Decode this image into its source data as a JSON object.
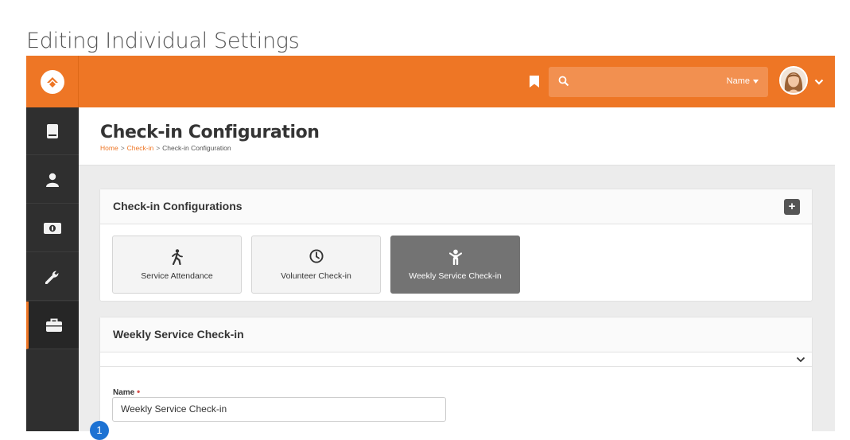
{
  "doc": {
    "heading": "Editing Individual Settings",
    "step_number": "1"
  },
  "topbar": {
    "search_filter_label": "Name",
    "colors": {
      "brand": "#ee7625",
      "sidebar": "#2f2f2f"
    }
  },
  "sidebar": {
    "items": [
      {
        "icon": "book-icon"
      },
      {
        "icon": "person-icon"
      },
      {
        "icon": "money-icon"
      },
      {
        "icon": "wrench-icon"
      },
      {
        "icon": "briefcase-icon",
        "active": true
      }
    ]
  },
  "page": {
    "title": "Check-in Configuration",
    "breadcrumb": [
      "Home",
      "Check-in",
      "Check-in Configuration"
    ],
    "breadcrumb_separator": ">"
  },
  "configs_panel": {
    "title": "Check-in Configurations",
    "add_label": "+",
    "cards": [
      {
        "label": "Service Attendance",
        "icon": "walking-person-icon"
      },
      {
        "label": "Volunteer Check-in",
        "icon": "clock-icon"
      },
      {
        "label": "Weekly Service Check-in",
        "icon": "child-icon",
        "selected": true
      }
    ]
  },
  "detail_panel": {
    "title": "Weekly Service Check-in",
    "name_label": "Name",
    "required_mark": "•",
    "name_value": "Weekly Service Check-in"
  }
}
